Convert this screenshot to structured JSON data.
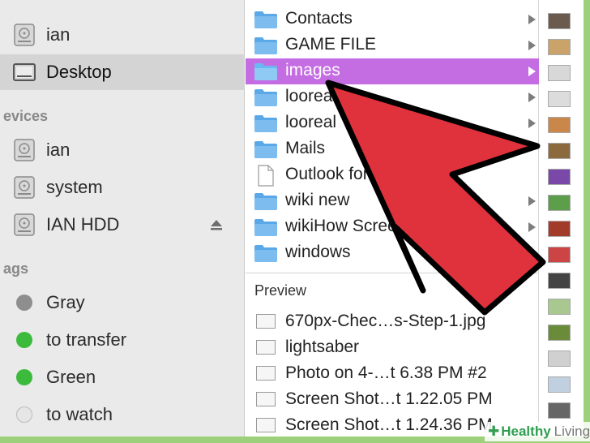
{
  "sidebar": {
    "items_top": [
      {
        "label": "ian",
        "icon": "disk-icon"
      },
      {
        "label": "Desktop",
        "icon": "desktop-icon",
        "selected": true
      }
    ],
    "devices_header": "evices",
    "devices": [
      {
        "label": "ian",
        "icon": "disk-icon"
      },
      {
        "label": "system",
        "icon": "disk-icon"
      },
      {
        "label": "IAN HDD",
        "icon": "disk-icon",
        "eject": true
      }
    ],
    "tags_header": "ags",
    "tags": [
      {
        "label": "Gray",
        "color": "#8e8e8e"
      },
      {
        "label": "to transfer",
        "color": "#3cba3c"
      },
      {
        "label": "Green",
        "color": "#3cba3c"
      },
      {
        "label": "to watch",
        "color": "#e6e6e6"
      }
    ]
  },
  "column2": {
    "rows": [
      {
        "label": "Contacts",
        "type": "folder",
        "chevron": true
      },
      {
        "label": "GAME FILE",
        "type": "folder",
        "chevron": true
      },
      {
        "label": "images",
        "type": "folder",
        "chevron": true,
        "selected": true
      },
      {
        "label": "looreal",
        "type": "folder",
        "chevron": true
      },
      {
        "label": "looreal",
        "type": "folder",
        "chevron": true
      },
      {
        "label": "Mails",
        "type": "folder",
        "chevron": false
      },
      {
        "label": "Outlook for Mac.htm",
        "type": "document",
        "chevron": false
      },
      {
        "label": "wiki new",
        "type": "folder",
        "chevron": true
      },
      {
        "label": "wikiHow Screenshots",
        "type": "folder",
        "chevron": true
      },
      {
        "label": "windows",
        "type": "folder",
        "chevron": false
      }
    ],
    "preview_header": "Preview",
    "preview_rows": [
      {
        "label": "670px-Chec…s-Step-1.jpg"
      },
      {
        "label": "lightsaber"
      },
      {
        "label": "Photo on 4-…t 6.38 PM #2"
      },
      {
        "label": "Screen Shot…t 1.22.05 PM"
      },
      {
        "label": "Screen Shot…t 1.24.36 PM"
      }
    ]
  },
  "column3": {
    "thumbnail_colors": [
      "#6b5a4e",
      "#c9a36a",
      "#d8d8d8",
      "#dcdcdc",
      "#c9874a",
      "#8b6a3e",
      "#7a48a8",
      "#5c9e4a",
      "#a33b2b",
      "#cc4444",
      "#444444",
      "#a8c890",
      "#6a8c3a",
      "#d0d0d0",
      "#c0d0e0",
      "#666666"
    ]
  },
  "watermark": {
    "brand": "Healthy",
    "suffix": "Living"
  },
  "colors": {
    "selection": "#c46de3",
    "folder": "#5aa8e8",
    "arrow_fill": "#e0323c",
    "arrow_stroke": "#000000",
    "border": "#9dd07a"
  }
}
